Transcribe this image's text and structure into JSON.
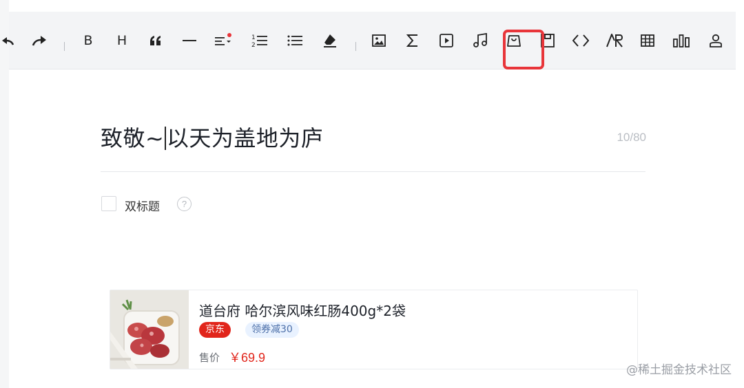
{
  "toolbar": {
    "items": [
      {
        "name": "undo-icon"
      },
      {
        "name": "redo-icon"
      },
      {
        "name": "bold",
        "label": "B"
      },
      {
        "name": "heading",
        "label": "H"
      },
      {
        "name": "quote-icon"
      },
      {
        "name": "horizontal-rule-icon"
      },
      {
        "name": "align-icon"
      },
      {
        "name": "ordered-list-icon"
      },
      {
        "name": "unordered-list-icon"
      },
      {
        "name": "clear-format-icon"
      },
      {
        "name": "image-icon"
      },
      {
        "name": "formula-icon"
      },
      {
        "name": "video-icon"
      },
      {
        "name": "audio-icon"
      },
      {
        "name": "product-icon"
      },
      {
        "name": "save-icon"
      },
      {
        "name": "code-icon"
      },
      {
        "name": "ar-icon"
      },
      {
        "name": "table-icon"
      },
      {
        "name": "chart-icon"
      },
      {
        "name": "user-icon"
      }
    ],
    "highlight_color": "#e8353a",
    "notification_dot_color": "#e8353a"
  },
  "editor": {
    "title_before_caret": "致敬~",
    "title_after_caret": "以天为盖地为庐",
    "char_counter": "10/80",
    "double_title_label": "双标题",
    "help_icon_glyph": "?"
  },
  "product": {
    "title": "道台府 哈尔滨风味红肠400g*2袋",
    "store_tag": "京东",
    "coupon_tag": "领券减30",
    "price_label": "售价",
    "price": "￥69.9"
  },
  "watermark": {
    "site": "@稀土掘金技术社区"
  }
}
